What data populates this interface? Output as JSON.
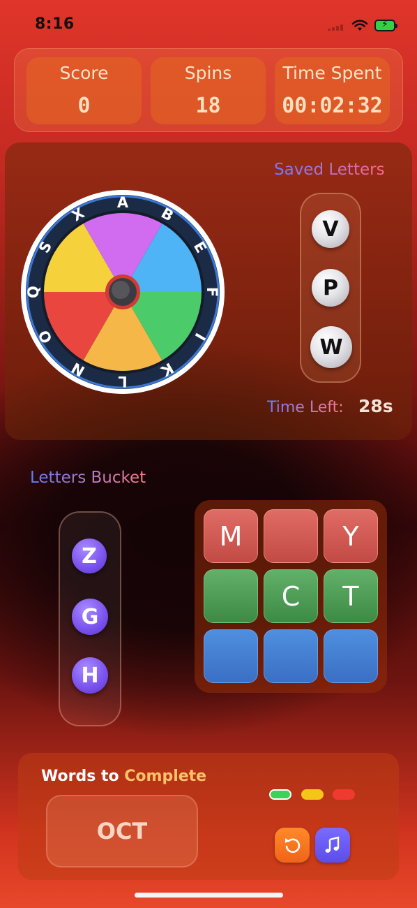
{
  "status": {
    "time": "8:16"
  },
  "stats": [
    {
      "label": "Score",
      "value": "0"
    },
    {
      "label": "Spins",
      "value": "18"
    },
    {
      "label": "Time Spent",
      "value": "00:02:32"
    }
  ],
  "wheel": {
    "letters": [
      "A",
      "B",
      "E",
      "F",
      "I",
      "K",
      "L",
      "N",
      "O",
      "Q",
      "S",
      "X"
    ],
    "segment_colors": [
      "#4fb4f5",
      "#4ccb6a",
      "#f5b748",
      "#e8463e",
      "#f5d23c",
      "#d16bf0"
    ]
  },
  "saved": {
    "title": "Saved Letters",
    "letters": [
      "V",
      "P",
      "W"
    ],
    "time_left_label": "Time Left:",
    "time_left_value": "28s"
  },
  "bucket": {
    "title": "Letters Bucket",
    "letters": [
      "Z",
      "G",
      "H"
    ]
  },
  "grid": {
    "rows": [
      {
        "color": "red",
        "cells": [
          "M",
          "",
          "Y"
        ]
      },
      {
        "color": "green",
        "cells": [
          "",
          "C",
          "T"
        ]
      },
      {
        "color": "blue",
        "cells": [
          "",
          "",
          ""
        ]
      }
    ]
  },
  "words": {
    "title_part1": "Words to",
    "title_part2": "Complete",
    "current_word": "OCT",
    "indicator_colors": [
      "#3fd05a",
      "#f5c518",
      "#f03a30"
    ]
  },
  "buttons": {
    "undo_icon": "undo-icon",
    "music_icon": "music-icon"
  }
}
